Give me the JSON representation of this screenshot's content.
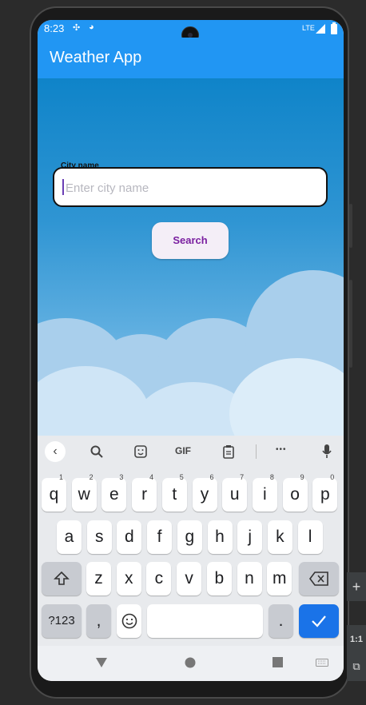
{
  "status_bar": {
    "time": "8:23",
    "network": "LTE"
  },
  "app_bar": {
    "title": "Weather App"
  },
  "search": {
    "label": "City name",
    "placeholder": "Enter city name",
    "value": "",
    "button_label": "Search"
  },
  "keyboard": {
    "toolbar": {
      "back": "‹",
      "gif": "GIF",
      "more": "•••"
    },
    "row1": [
      {
        "key": "q",
        "hint": "1"
      },
      {
        "key": "w",
        "hint": "2"
      },
      {
        "key": "e",
        "hint": "3"
      },
      {
        "key": "r",
        "hint": "4"
      },
      {
        "key": "t",
        "hint": "5"
      },
      {
        "key": "y",
        "hint": "6"
      },
      {
        "key": "u",
        "hint": "7"
      },
      {
        "key": "i",
        "hint": "8"
      },
      {
        "key": "o",
        "hint": "9"
      },
      {
        "key": "p",
        "hint": "0"
      }
    ],
    "row2": [
      "a",
      "s",
      "d",
      "f",
      "g",
      "h",
      "j",
      "k",
      "l"
    ],
    "row3": [
      "z",
      "x",
      "c",
      "v",
      "b",
      "n",
      "m"
    ],
    "symbols_label": "?123",
    "comma": ",",
    "period": "."
  },
  "emulator_tools": {
    "zoom_label": "1:1"
  },
  "colors": {
    "primary": "#2196f3",
    "button_text": "#7a1fa0",
    "enter_key": "#1a73e8"
  }
}
